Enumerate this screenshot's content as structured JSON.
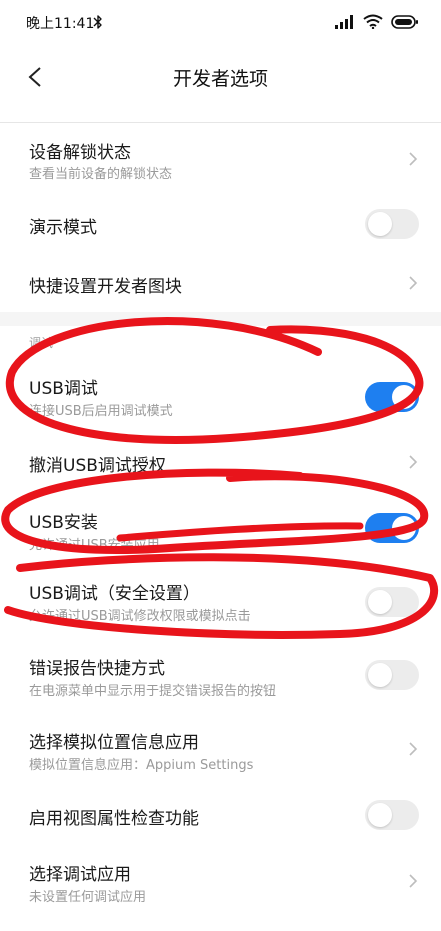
{
  "status_bar": {
    "time": "晚上11:41"
  },
  "header": {
    "title": "开发者选项"
  },
  "rows": [
    {
      "label": "设备解锁状态",
      "sub": "查看当前设备的解锁状态"
    },
    {
      "label": "演示模式"
    },
    {
      "label": "快捷设置开发者图块"
    },
    {
      "label": "USB调试",
      "sub": "连接USB后启用调试模式"
    },
    {
      "label": "撤消USB调试授权"
    },
    {
      "label": "USB安装",
      "sub": "允许通过USB安装应用"
    },
    {
      "label": "USB调试（安全设置）",
      "sub": "允许通过USB调试修改权限或模拟点击"
    },
    {
      "label": "错误报告快捷方式",
      "sub": "在电源菜单中显示用于提交错误报告的按钮"
    },
    {
      "label": "选择模拟位置信息应用",
      "sub": "模拟位置信息应用：Appium Settings"
    },
    {
      "label": "启用视图属性检查功能"
    },
    {
      "label": "选择调试应用",
      "sub": "未设置任何调试应用"
    }
  ],
  "section": {
    "label": "调试"
  },
  "toggles": {
    "demo_mode": false,
    "usb_debugging": true,
    "usb_install": true,
    "usb_debugging_security": false,
    "bug_report_shortcut": false,
    "view_attribute_inspection": false
  },
  "colors": {
    "accent": "#1e7ff0",
    "annotation": "#e8141b",
    "toggle_off": "#ececec"
  },
  "icons": [
    "bluetooth-icon",
    "signal-icon",
    "wifi-icon",
    "battery-icon",
    "back-arrow-icon",
    "chevron-right-icon"
  ]
}
